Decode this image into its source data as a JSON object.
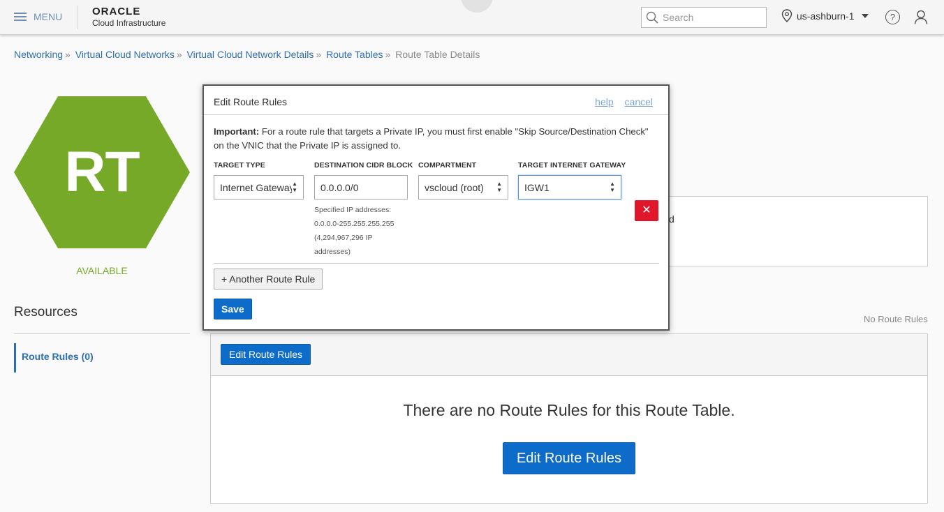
{
  "header": {
    "menu_label": "MENU",
    "logo_main": "ORACLE",
    "logo_sub": "Cloud Infrastructure",
    "search_placeholder": "Search",
    "region": "us-ashburn-1"
  },
  "breadcrumb": {
    "items": [
      "Networking",
      "Virtual Cloud Networks",
      "Virtual Cloud Network Details",
      "Route Tables"
    ],
    "current": "Route Table Details",
    "separator": "»"
  },
  "resource": {
    "icon_text": "RT",
    "status": "AVAILABLE",
    "status_color": "#76a927"
  },
  "resources": {
    "title": "Resources",
    "items": [
      {
        "label": "Route Rules (0)"
      }
    ]
  },
  "main": {
    "info_fragment": "d",
    "no_rules_small": "No Route Rules",
    "edit_button_small": "Edit Route Rules",
    "empty_message": "There are no Route Rules for this Route Table.",
    "edit_button_large": "Edit Route Rules"
  },
  "modal": {
    "title": "Edit Route Rules",
    "help_link": "help",
    "cancel_link": "cancel",
    "important_label": "Important:",
    "important_text": "For a route rule that targets a Private IP, you must first enable \"Skip Source/Destination Check\" on the VNIC that the Private IP is assigned to.",
    "columns": {
      "target_type": "TARGET TYPE",
      "destination_cidr": "DESTINATION CIDR BLOCK",
      "compartment": "COMPARTMENT",
      "target_gateway": "TARGET INTERNET GATEWAY"
    },
    "rule": {
      "target_type": "Internet Gateway",
      "destination_cidr": "0.0.0.0/0",
      "compartment": "vscloud (root)",
      "target_gateway": "IGW1"
    },
    "cidr_help": [
      "Specified IP addresses:",
      "0.0.0.0-255.255.255.255",
      "(4,294,967,296 IP",
      "addresses)"
    ],
    "delete_glyph": "✕",
    "add_rule_button": "+ Another Route Rule",
    "save_button": "Save"
  },
  "colors": {
    "brand_blue": "#0d6bc9",
    "link_blue": "#2d6eb2",
    "hexagon_green": "#76a927",
    "delete_red": "#e0162b"
  }
}
